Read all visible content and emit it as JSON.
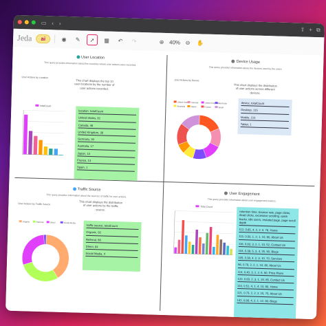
{
  "app": {
    "logo_text": "Jeda",
    "ai_label": "ai",
    "zoom_level": "40%"
  },
  "panels": {
    "location": {
      "title": "User Location",
      "subtitle": "This query provides information about the countries where user actions were recorded.",
      "chart_label": "User Actions by Location",
      "description": "This chart displays the top 10 user locations by the number of user actions recorded.",
      "header": "location, totalCount",
      "rows": [
        "United States, 81",
        "Canada, 48",
        "United Kingdom, 38",
        "Germany, 30",
        "Australia, 17",
        "Japan, 13",
        "France, 13",
        "Spain, 1"
      ],
      "legend": "totalCount"
    },
    "device": {
      "title": "Device Usage",
      "subtitle": "This query provides information about the devices used by the users.",
      "chart_label": "User Actions by Device",
      "description": "This chart displays the distribution of user actions across different devices.",
      "header": "device, totalCount",
      "rows": [
        "Desktop, 115",
        "Mobile, 110",
        "Tablet, 1"
      ],
      "legend": [
        "United States",
        "Canada",
        "United Kingdom",
        "Germany",
        "Australia",
        "Japan",
        "France",
        "Spain"
      ]
    },
    "traffic": {
      "title": "Traffic Source",
      "subtitle": "This query provides information about the sources of traffic for user actions.",
      "chart_label": "User Actions by Traffic Source",
      "description": "This chart displays the distribution of user actions by the traffic source.",
      "header": "traffic source, totalCount",
      "rows": [
        "Organic, 92",
        "Referral, 66",
        "Direct, 64",
        "Social Media, 4"
      ],
      "legend": [
        "Organic",
        "Referral",
        "Direct",
        "Social Media"
      ]
    },
    "engagement": {
      "title": "User Engagement",
      "subtitle": "This query provides information about user engagement metrics.",
      "chart_label": "",
      "header": "retention time, bounce rate, page clicks, dead clicks, excessive scrolling, quick backs, idle users, restated page, page scroll depth",
      "rows": [
        "112, 0.65, 4, 2, 2, 0, 76, Home",
        "113, 0.93, 1, 2, 1, 10, 80, About Us",
        "116, 0.83, 3, 2, 1, 10, 52, Contact Us",
        "104, 0.38, 5, 3, 4, 25, 90, Blogs",
        "105, 0.38, 4, 2, 3, 10, 70, Services",
        "96, 0.79, 2, 2, 1, 10, 80, About Us",
        "114, 0.40, 3, 2, 2, 5, 90, Price Plans",
        "120, 0.83, 2, 3, 1, 20, 65, Contact Us",
        "110, 0.51, 4, 1, 4, 10, 80, Home",
        "121, 0.73, 2, 2, 2, 15, 75, About Us",
        "142, 0.89, 4, 2, 1, 12, 80, Blogs"
      ],
      "legend": "Total Count"
    }
  },
  "chart_data": [
    {
      "type": "bar",
      "categories": [
        "United States",
        "Canada",
        "United Kingdom",
        "Germany",
        "Australia",
        "Japan",
        "France",
        "Spain"
      ],
      "values": [
        81,
        48,
        38,
        30,
        17,
        13,
        13,
        1
      ],
      "colors": [
        "#e040fb",
        "#ab47bc",
        "#f06292",
        "#ff9800",
        "#ffc107",
        "#26a69a",
        "#42a5f5",
        "#26c6da"
      ],
      "ylim": [
        0,
        90
      ]
    },
    {
      "type": "pie",
      "labels": [
        "Desktop",
        "Mobile",
        "Tablet"
      ],
      "values": [
        115,
        110,
        1
      ],
      "colors": [
        "#ff5722",
        "#f48fb1",
        "#e040fb",
        "#7c4dff",
        "#ffeb3b",
        "#ff9800",
        "#ef5350",
        "#ce93d8"
      ],
      "segments": [
        18,
        14,
        12,
        10,
        8,
        7,
        16,
        15
      ]
    },
    {
      "type": "pie",
      "labels": [
        "Organic",
        "Referral",
        "Direct",
        "Social Media"
      ],
      "values": [
        92,
        66,
        64,
        4
      ],
      "colors": [
        "#ffab70",
        "#b2ff59",
        "#e040fb",
        "#7c4dff"
      ]
    },
    {
      "type": "bar",
      "categories": [
        "1",
        "2",
        "3",
        "4",
        "5",
        "6",
        "7",
        "8",
        "9",
        "10",
        "11",
        "12",
        "13",
        "14",
        "15",
        "16",
        "17"
      ],
      "values": [
        20,
        45,
        110,
        60,
        40,
        30,
        80,
        55,
        35,
        70,
        90,
        25,
        65,
        50,
        40,
        30,
        20
      ],
      "colors": [
        "#e040fb",
        "#f06292",
        "#ef5350",
        "#42a5f5",
        "#ffca28",
        "#26a69a",
        "#ab47bc",
        "#ff7043",
        "#7986cb",
        "#66bb6a",
        "#ec407a",
        "#29b6f6",
        "#ffa726",
        "#8d6e63",
        "#5c6bc0",
        "#26c6da",
        "#d4e157"
      ],
      "ylim": [
        0,
        140
      ]
    }
  ]
}
